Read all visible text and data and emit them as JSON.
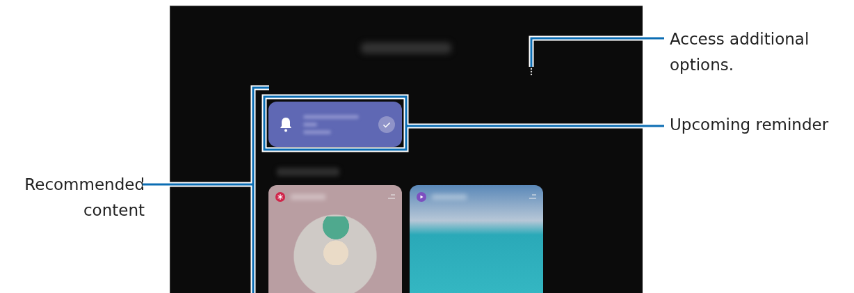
{
  "callouts": [
    {
      "kind": "right",
      "text": "Access additional options."
    },
    {
      "kind": "right",
      "text": "Upcoming reminder"
    },
    {
      "kind": "left",
      "text": "Recommended content"
    }
  ]
}
